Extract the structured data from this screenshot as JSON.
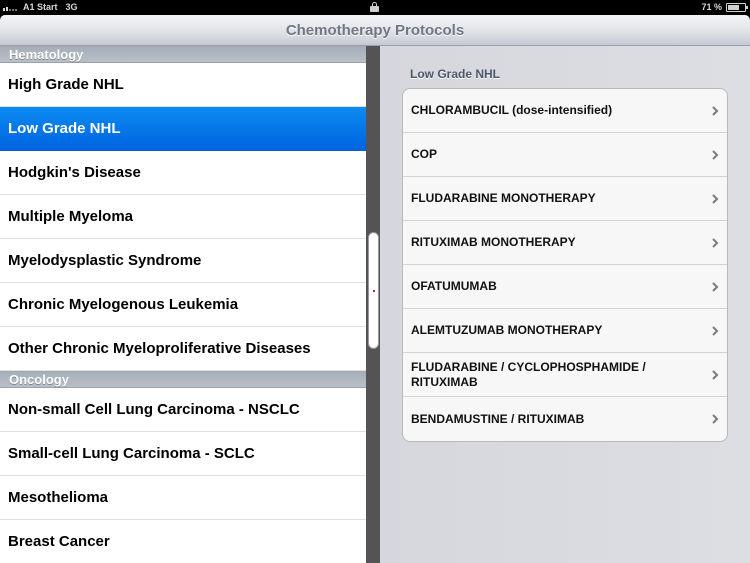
{
  "status_bar": {
    "carrier": "A1 Start",
    "network": "3G",
    "signal_bars": 2,
    "battery_percent_label": "71 %",
    "battery_level": 0.71,
    "icons": [
      "signal-icon",
      "lock-icon",
      "battery-icon"
    ]
  },
  "nav": {
    "title": "Chemotherapy Protocols"
  },
  "master": {
    "sections": [
      {
        "header": "Hematology",
        "items": [
          {
            "label": "High Grade NHL",
            "selected": false
          },
          {
            "label": "Low Grade NHL",
            "selected": true
          },
          {
            "label": "Hodgkin's Disease",
            "selected": false
          },
          {
            "label": "Multiple Myeloma",
            "selected": false
          },
          {
            "label": "Myelodysplastic Syndrome",
            "selected": false
          },
          {
            "label": "Chronic Myelogenous Leukemia",
            "selected": false
          },
          {
            "label": "Other Chronic Myeloproliferative Diseases",
            "selected": false
          }
        ]
      },
      {
        "header": "Oncology",
        "items": [
          {
            "label": "Non-small Cell Lung Carcinoma - NSCLC",
            "selected": false
          },
          {
            "label": "Small-cell Lung Carcinoma - SCLC",
            "selected": false
          },
          {
            "label": "Mesothelioma",
            "selected": false
          },
          {
            "label": "Breast Cancer",
            "selected": false
          }
        ]
      }
    ]
  },
  "detail": {
    "header": "Low Grade NHL",
    "rows": [
      {
        "label": "CHLORAMBUCIL (dose-intensified)"
      },
      {
        "label": "COP"
      },
      {
        "label": "FLUDARABINE MONOTHERAPY"
      },
      {
        "label": "RITUXIMAB MONOTHERAPY"
      },
      {
        "label": "OFATUMUMAB"
      },
      {
        "label": "ALEMTUZUMAB MONOTHERAPY"
      },
      {
        "label": "FLUDARABINE / CYCLOPHOSPHAMIDE / RITUXIMAB"
      },
      {
        "label": "BENDAMUSTINE / RITUXIMAB"
      }
    ]
  },
  "colors": {
    "selection": "#0a7ae8",
    "nav_title": "#707683",
    "section_header_bg": "#aeb6bf",
    "divider": "#545454",
    "detail_bg": "#d8dade"
  }
}
